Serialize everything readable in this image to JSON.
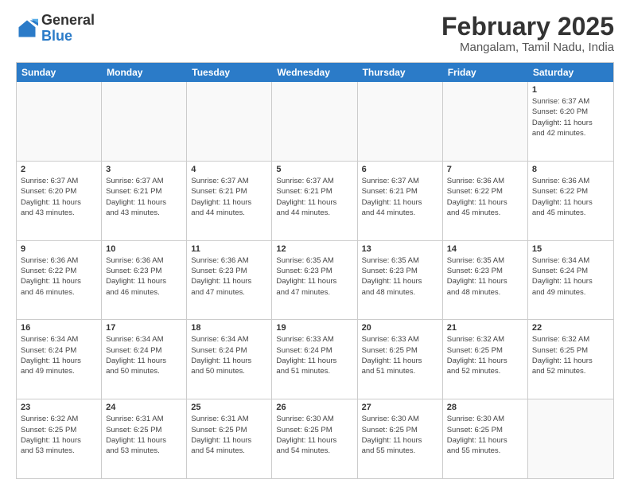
{
  "header": {
    "logo": {
      "line1": "General",
      "line2": "Blue"
    },
    "month": "February 2025",
    "location": "Mangalam, Tamil Nadu, India"
  },
  "days_of_week": [
    "Sunday",
    "Monday",
    "Tuesday",
    "Wednesday",
    "Thursday",
    "Friday",
    "Saturday"
  ],
  "weeks": [
    [
      {
        "day": "",
        "info": ""
      },
      {
        "day": "",
        "info": ""
      },
      {
        "day": "",
        "info": ""
      },
      {
        "day": "",
        "info": ""
      },
      {
        "day": "",
        "info": ""
      },
      {
        "day": "",
        "info": ""
      },
      {
        "day": "1",
        "info": "Sunrise: 6:37 AM\nSunset: 6:20 PM\nDaylight: 11 hours\nand 42 minutes."
      }
    ],
    [
      {
        "day": "2",
        "info": "Sunrise: 6:37 AM\nSunset: 6:20 PM\nDaylight: 11 hours\nand 43 minutes."
      },
      {
        "day": "3",
        "info": "Sunrise: 6:37 AM\nSunset: 6:21 PM\nDaylight: 11 hours\nand 43 minutes."
      },
      {
        "day": "4",
        "info": "Sunrise: 6:37 AM\nSunset: 6:21 PM\nDaylight: 11 hours\nand 44 minutes."
      },
      {
        "day": "5",
        "info": "Sunrise: 6:37 AM\nSunset: 6:21 PM\nDaylight: 11 hours\nand 44 minutes."
      },
      {
        "day": "6",
        "info": "Sunrise: 6:37 AM\nSunset: 6:21 PM\nDaylight: 11 hours\nand 44 minutes."
      },
      {
        "day": "7",
        "info": "Sunrise: 6:36 AM\nSunset: 6:22 PM\nDaylight: 11 hours\nand 45 minutes."
      },
      {
        "day": "8",
        "info": "Sunrise: 6:36 AM\nSunset: 6:22 PM\nDaylight: 11 hours\nand 45 minutes."
      }
    ],
    [
      {
        "day": "9",
        "info": "Sunrise: 6:36 AM\nSunset: 6:22 PM\nDaylight: 11 hours\nand 46 minutes."
      },
      {
        "day": "10",
        "info": "Sunrise: 6:36 AM\nSunset: 6:23 PM\nDaylight: 11 hours\nand 46 minutes."
      },
      {
        "day": "11",
        "info": "Sunrise: 6:36 AM\nSunset: 6:23 PM\nDaylight: 11 hours\nand 47 minutes."
      },
      {
        "day": "12",
        "info": "Sunrise: 6:35 AM\nSunset: 6:23 PM\nDaylight: 11 hours\nand 47 minutes."
      },
      {
        "day": "13",
        "info": "Sunrise: 6:35 AM\nSunset: 6:23 PM\nDaylight: 11 hours\nand 48 minutes."
      },
      {
        "day": "14",
        "info": "Sunrise: 6:35 AM\nSunset: 6:23 PM\nDaylight: 11 hours\nand 48 minutes."
      },
      {
        "day": "15",
        "info": "Sunrise: 6:34 AM\nSunset: 6:24 PM\nDaylight: 11 hours\nand 49 minutes."
      }
    ],
    [
      {
        "day": "16",
        "info": "Sunrise: 6:34 AM\nSunset: 6:24 PM\nDaylight: 11 hours\nand 49 minutes."
      },
      {
        "day": "17",
        "info": "Sunrise: 6:34 AM\nSunset: 6:24 PM\nDaylight: 11 hours\nand 50 minutes."
      },
      {
        "day": "18",
        "info": "Sunrise: 6:34 AM\nSunset: 6:24 PM\nDaylight: 11 hours\nand 50 minutes."
      },
      {
        "day": "19",
        "info": "Sunrise: 6:33 AM\nSunset: 6:24 PM\nDaylight: 11 hours\nand 51 minutes."
      },
      {
        "day": "20",
        "info": "Sunrise: 6:33 AM\nSunset: 6:25 PM\nDaylight: 11 hours\nand 51 minutes."
      },
      {
        "day": "21",
        "info": "Sunrise: 6:32 AM\nSunset: 6:25 PM\nDaylight: 11 hours\nand 52 minutes."
      },
      {
        "day": "22",
        "info": "Sunrise: 6:32 AM\nSunset: 6:25 PM\nDaylight: 11 hours\nand 52 minutes."
      }
    ],
    [
      {
        "day": "23",
        "info": "Sunrise: 6:32 AM\nSunset: 6:25 PM\nDaylight: 11 hours\nand 53 minutes."
      },
      {
        "day": "24",
        "info": "Sunrise: 6:31 AM\nSunset: 6:25 PM\nDaylight: 11 hours\nand 53 minutes."
      },
      {
        "day": "25",
        "info": "Sunrise: 6:31 AM\nSunset: 6:25 PM\nDaylight: 11 hours\nand 54 minutes."
      },
      {
        "day": "26",
        "info": "Sunrise: 6:30 AM\nSunset: 6:25 PM\nDaylight: 11 hours\nand 54 minutes."
      },
      {
        "day": "27",
        "info": "Sunrise: 6:30 AM\nSunset: 6:25 PM\nDaylight: 11 hours\nand 55 minutes."
      },
      {
        "day": "28",
        "info": "Sunrise: 6:30 AM\nSunset: 6:25 PM\nDaylight: 11 hours\nand 55 minutes."
      },
      {
        "day": "",
        "info": ""
      }
    ]
  ]
}
